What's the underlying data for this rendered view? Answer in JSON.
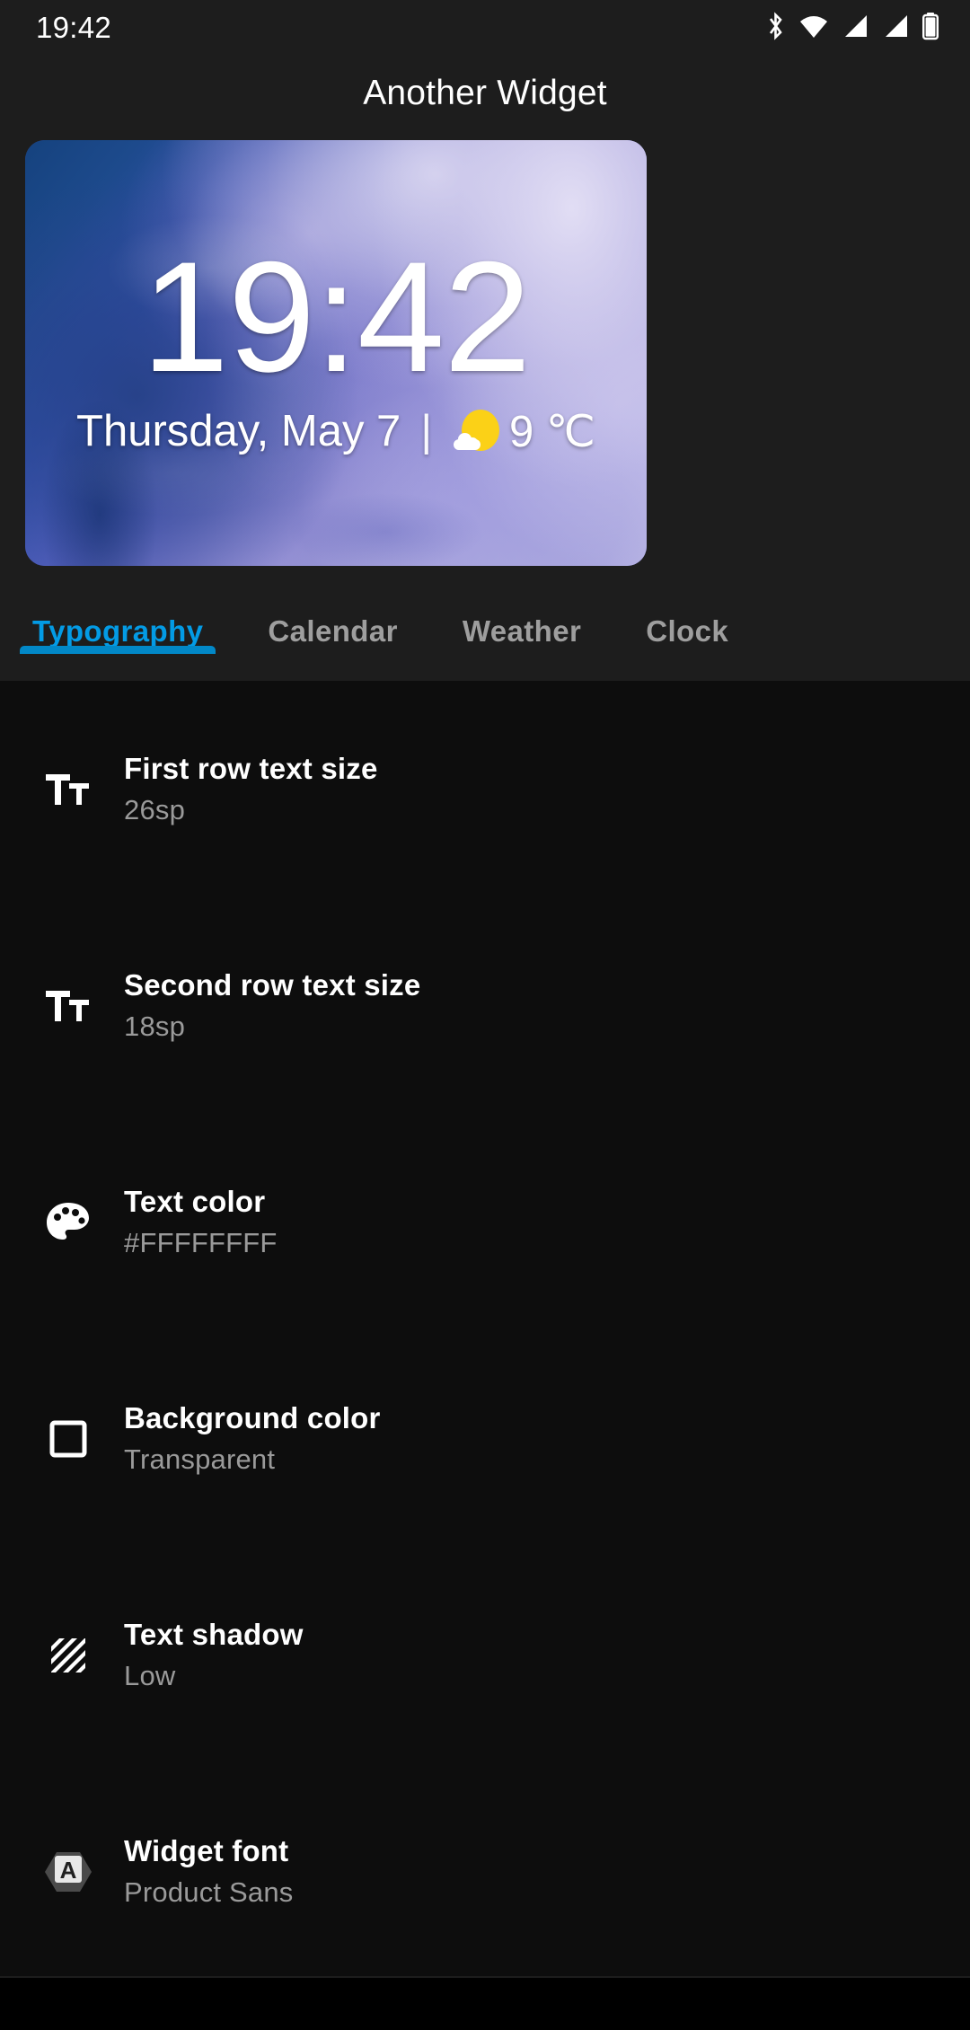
{
  "status_bar": {
    "time": "19:42",
    "icons": [
      "bluetooth-icon",
      "wifi-icon",
      "signal-1-icon",
      "signal-2-icon",
      "battery-icon"
    ]
  },
  "header": {
    "title": "Another Widget"
  },
  "widget_preview": {
    "clock": "19:42",
    "date": "Thursday, May 7",
    "separator": "|",
    "weather_icon": "sun-behind-cloud-icon",
    "temperature": "9 ℃"
  },
  "tabs": [
    {
      "label": "Typography",
      "active": true
    },
    {
      "label": "Calendar",
      "active": false
    },
    {
      "label": "Weather",
      "active": false
    },
    {
      "label": "Clock",
      "active": false
    }
  ],
  "settings": [
    {
      "icon": "format-size-icon",
      "title": "First row text size",
      "value": "26sp"
    },
    {
      "icon": "format-size-icon",
      "title": "Second row text size",
      "value": "18sp"
    },
    {
      "icon": "palette-icon",
      "title": "Text color",
      "value": "#FFFFFFFF"
    },
    {
      "icon": "square-outline-icon",
      "title": "Background color",
      "value": "Transparent"
    },
    {
      "icon": "diagonal-hatch-icon",
      "title": "Text shadow",
      "value": "Low"
    },
    {
      "icon": "font-hexagon-icon",
      "title": "Widget font",
      "value": "Product Sans"
    }
  ],
  "colors": {
    "accent": "#039BE5",
    "indicator": "#0288c7",
    "background": "#1d1d1d",
    "list_background": "#0d0d0d",
    "title_text": "#FFFFFF",
    "subtitle_text": "#9A9A9A"
  }
}
